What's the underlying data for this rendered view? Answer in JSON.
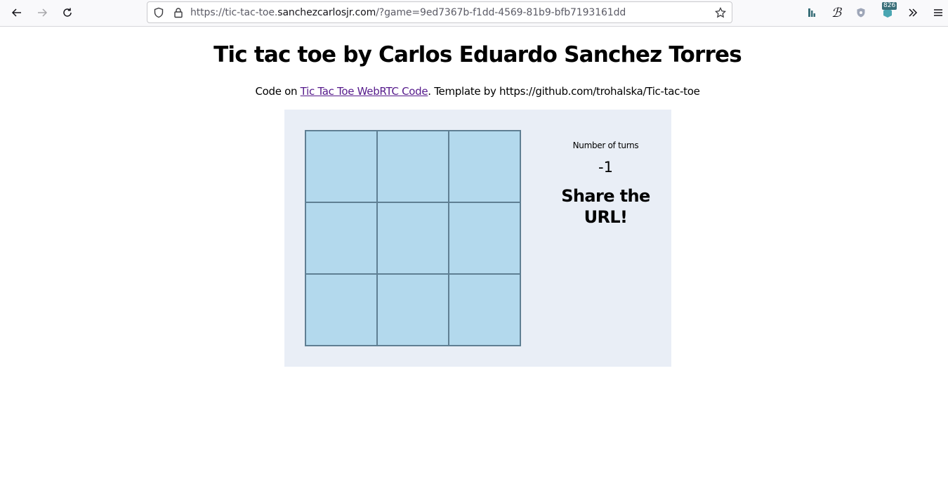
{
  "browser": {
    "url_prefix": "https://tic-tac-toe.",
    "url_domain": "sanchezcarlosjr.com",
    "url_rest": "/?game=9ed7367b-f1dd-4569-81b9-bfb7193161dd",
    "extension_badge": "826",
    "icons": {
      "back": "arrow-left-icon",
      "forward": "arrow-right-icon",
      "reload": "reload-icon",
      "tracking": "shield-icon",
      "secure": "lock-icon",
      "bookmark": "star-icon",
      "overflow": "chevron-double-right-icon",
      "menu": "hamburger-menu-icon"
    }
  },
  "page": {
    "title": "Tic tac toe by Carlos Eduardo Sanchez Torres",
    "credits_prefix": "Code on ",
    "credits_link": "Tic Tac Toe WebRTC Code",
    "credits_suffix": ". Template by https://github.com/trohalska/Tic-tac-toe"
  },
  "game": {
    "cells": [
      "",
      "",
      "",
      "",
      "",
      "",
      "",
      "",
      ""
    ],
    "turns_label": "Number of turns",
    "turns_value": "-1",
    "share_message": "Share the URL!"
  },
  "colors": {
    "cell": "#b3d9ed",
    "panel": "#e9eef6",
    "link": "#551a8b"
  }
}
